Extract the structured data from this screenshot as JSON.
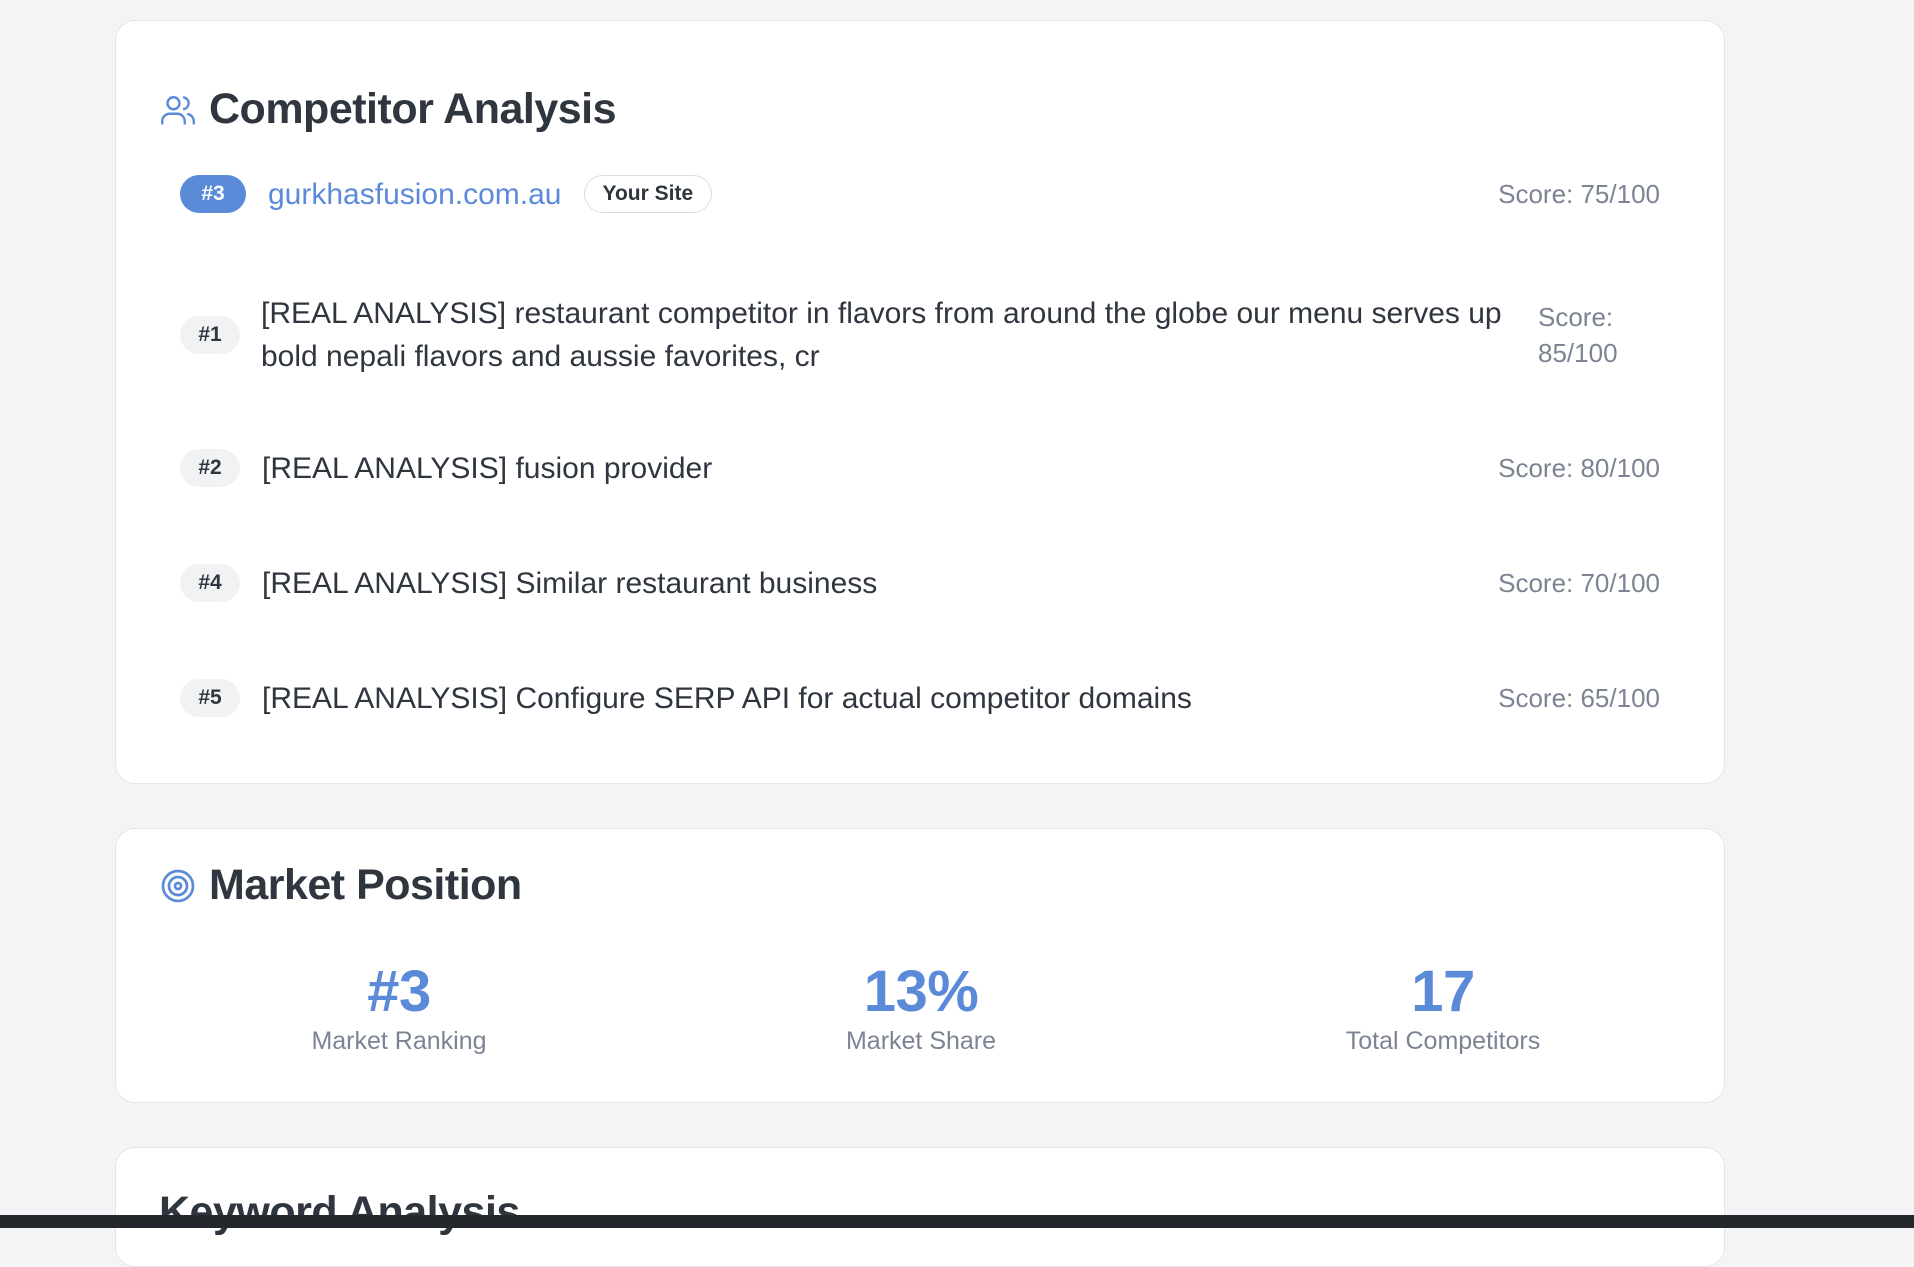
{
  "competitor_analysis": {
    "title": "Competitor Analysis",
    "icon": "users-icon",
    "own_site": {
      "rank": "#3",
      "domain": "gurkhasfusion.com.au",
      "tag": "Your Site",
      "score": "Score: 75/100"
    },
    "competitors": [
      {
        "rank": "#1",
        "name": "[REAL ANALYSIS] restaurant competitor in flavors from around the globe our menu serves up bold nepali flavors and aussie favorites, cr",
        "score": "Score: 85/100"
      },
      {
        "rank": "#2",
        "name": "[REAL ANALYSIS] fusion provider",
        "score": "Score: 80/100"
      },
      {
        "rank": "#4",
        "name": "[REAL ANALYSIS] Similar restaurant business",
        "score": "Score: 70/100"
      },
      {
        "rank": "#5",
        "name": "[REAL ANALYSIS] Configure SERP API for actual competitor domains",
        "score": "Score: 65/100"
      }
    ]
  },
  "market_position": {
    "title": "Market Position",
    "icon": "target-icon",
    "stats": [
      {
        "value": "#3",
        "label": "Market Ranking"
      },
      {
        "value": "13%",
        "label": "Market Share"
      },
      {
        "value": "17",
        "label": "Total Competitors"
      }
    ]
  },
  "keyword_analysis": {
    "title": "Keyword Analysis"
  },
  "colors": {
    "accent": "#5b8ad8",
    "text": "#30363f",
    "muted": "#7c8494",
    "background": "#f3f4f6"
  }
}
